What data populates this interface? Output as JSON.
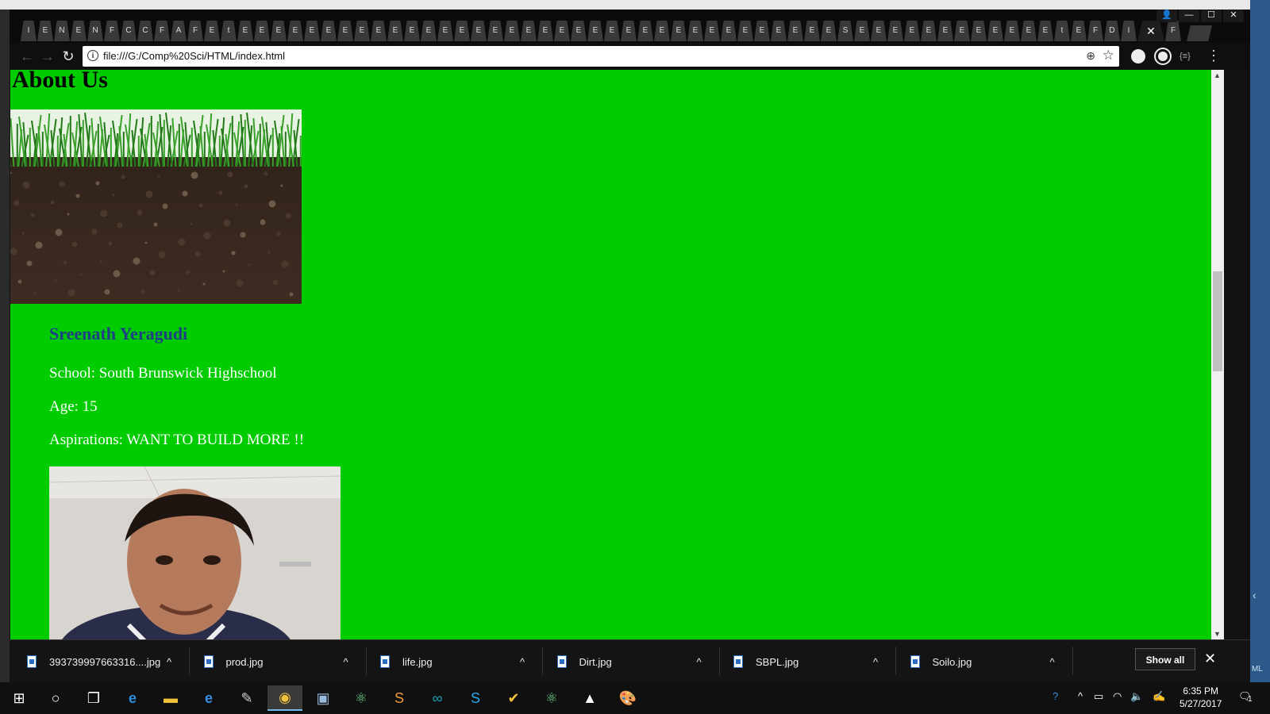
{
  "browser": {
    "tab_glyphs": [
      "I",
      "E",
      "N",
      "E",
      "N",
      "F",
      "C",
      "C",
      "F",
      "A",
      "F",
      "E",
      "t",
      "E",
      "E",
      "E",
      "E",
      "E",
      "E",
      "E",
      "E",
      "E",
      "E",
      "E",
      "E",
      "E",
      "E",
      "E",
      "E",
      "E",
      "E",
      "E",
      "E",
      "E",
      "E",
      "E",
      "E",
      "E",
      "E",
      "E",
      "E",
      "E",
      "E",
      "E",
      "E",
      "E",
      "E",
      "E",
      "E",
      "S",
      "E",
      "E",
      "E",
      "E",
      "E",
      "E",
      "E",
      "E",
      "E",
      "E",
      "E",
      "E",
      "t",
      "E",
      "F",
      "D",
      "I",
      "F"
    ],
    "active_tab_close": "✕",
    "address": "file:///G:/Comp%20Sci/HTML/index.html"
  },
  "page": {
    "heading": "About Us",
    "person": {
      "name": "Sreenath Yeragudi",
      "school": "School: South Brunswick Highschool",
      "age": "Age: 15",
      "aspirations": "Aspirations: WANT TO BUILD MORE !!"
    }
  },
  "downloads": {
    "items": [
      {
        "name": "393739997663316....jpg"
      },
      {
        "name": "prod.jpg"
      },
      {
        "name": "life.jpg"
      },
      {
        "name": "Dirt.jpg"
      },
      {
        "name": "SBPL.jpg"
      },
      {
        "name": "Soilo.jpg"
      }
    ],
    "show_all": "Show all"
  },
  "taskbar": {
    "time": "6:35 PM",
    "date": "5/27/2017",
    "notification_count": "1"
  },
  "colors": {
    "page_bg": "#00cc00",
    "name_color": "#1f3e86"
  }
}
